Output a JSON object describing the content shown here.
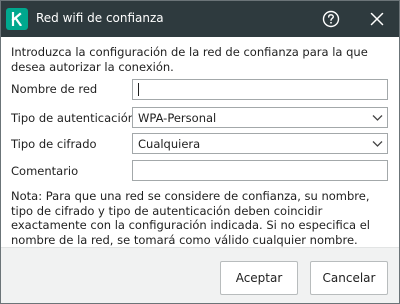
{
  "window": {
    "title": "Red wifi de confianza",
    "logo_letter": "k",
    "accent_color": "#00a88e",
    "titlebar_color": "#2e3a3e"
  },
  "intro_text": "Introduzca la configuración de la red de confianza para la que desea autorizar la conexión.",
  "form": {
    "network_name": {
      "label": "Nombre de red",
      "value": ""
    },
    "auth_type": {
      "label": "Tipo de autenticación",
      "value": "WPA-Personal"
    },
    "encryption_type": {
      "label": "Tipo de cifrado",
      "value": "Cualquiera"
    },
    "comment": {
      "label": "Comentario",
      "value": ""
    }
  },
  "note_text": "Nota: Para que una red se considere de confianza, su nombre, tipo de cifrado y tipo de autenticación deben coincidir exactamente con la configuración indicada. Si no especifica el nombre de la red, se tomará como válido cualquier nombre.",
  "buttons": {
    "accept": "Aceptar",
    "cancel": "Cancelar"
  },
  "icons": {
    "help": "help-circle-icon",
    "close": "close-icon",
    "dropdown": "chevron-down-icon"
  }
}
